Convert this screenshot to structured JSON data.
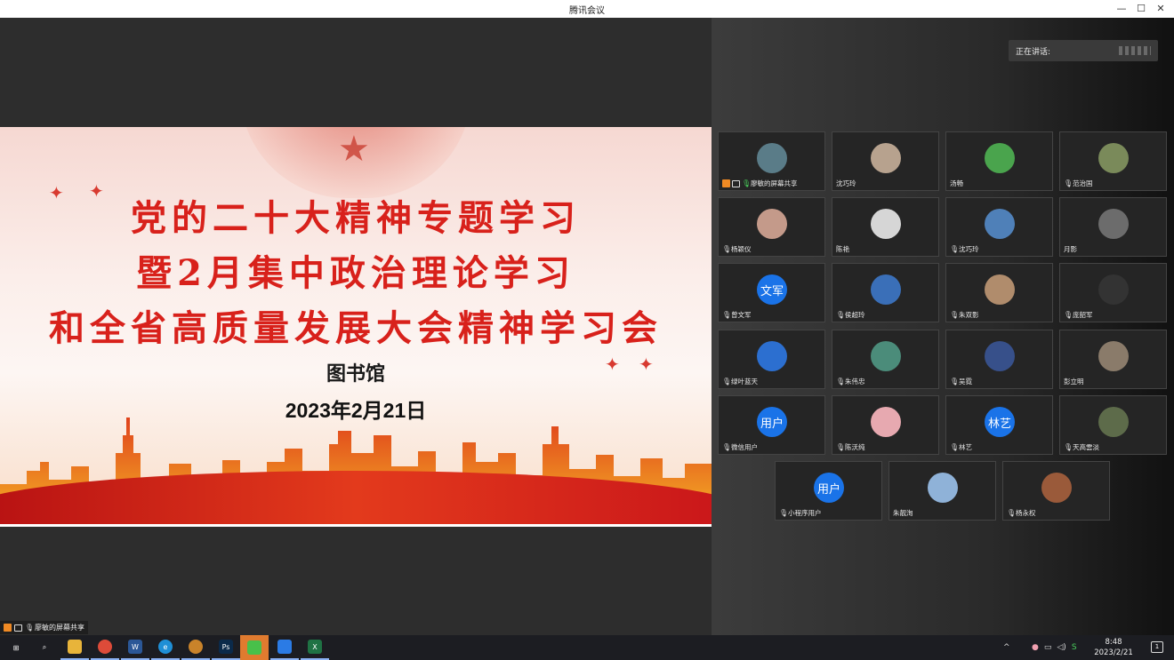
{
  "window": {
    "title": "腾讯会议",
    "minimize": "—",
    "maximize": "☐",
    "close": "✕"
  },
  "slide": {
    "line1": "党的二十大精神专题学习",
    "line2": "暨2月集中政治理论学习",
    "line3": "和全省高质量发展大会精神学习会",
    "org": "图书馆",
    "date": "2023年2月21日"
  },
  "speaking": {
    "label": "正在讲话:"
  },
  "participants": [
    {
      "name": "廖敏的屏幕共享",
      "avatar_color": "#5a7c88",
      "avatar_text": "",
      "mic": "live",
      "sharing": true
    },
    {
      "name": "沈巧玲",
      "avatar_color": "#b7a28e",
      "avatar_text": "",
      "mic": "none",
      "sharing": false
    },
    {
      "name": "汤畅",
      "avatar_color": "#4aa44d",
      "avatar_text": "",
      "mic": "none",
      "sharing": false
    },
    {
      "name": "范治国",
      "avatar_color": "#7a8a5a",
      "avatar_text": "",
      "mic": "muted",
      "sharing": false
    },
    {
      "name": "杨颖仪",
      "avatar_color": "#c49a8a",
      "avatar_text": "",
      "mic": "muted",
      "sharing": false
    },
    {
      "name": "陈艳",
      "avatar_color": "#d6d6d6",
      "avatar_text": "",
      "mic": "none",
      "sharing": false
    },
    {
      "name": "沈巧玲",
      "avatar_color": "#4f80b8",
      "avatar_text": "",
      "mic": "muted",
      "sharing": false
    },
    {
      "name": "月影",
      "avatar_color": "#6c6c6c",
      "avatar_text": "",
      "mic": "none",
      "sharing": false
    },
    {
      "name": "曾文军",
      "avatar_color": "#1a73e8",
      "avatar_text": "文军",
      "mic": "muted",
      "sharing": false
    },
    {
      "name": "侯超玲",
      "avatar_color": "#3a6fb8",
      "avatar_text": "",
      "mic": "muted",
      "sharing": false
    },
    {
      "name": "朱双影",
      "avatar_color": "#b08c6c",
      "avatar_text": "",
      "mic": "muted",
      "sharing": false
    },
    {
      "name": "庞韶军",
      "avatar_color": "#333333",
      "avatar_text": "",
      "mic": "muted",
      "sharing": false
    },
    {
      "name": "绿叶蓝天",
      "avatar_color": "#2c6fd0",
      "avatar_text": "",
      "mic": "muted",
      "sharing": false
    },
    {
      "name": "朱伟忠",
      "avatar_color": "#4b8c7a",
      "avatar_text": "",
      "mic": "muted",
      "sharing": false
    },
    {
      "name": "吴霓",
      "avatar_color": "#37508a",
      "avatar_text": "",
      "mic": "muted",
      "sharing": false
    },
    {
      "name": "彭立明",
      "avatar_color": "#8a7b6a",
      "avatar_text": "",
      "mic": "none",
      "sharing": false
    },
    {
      "name": "微信用户",
      "avatar_color": "#1a73e8",
      "avatar_text": "用户",
      "mic": "muted",
      "sharing": false
    },
    {
      "name": "陈沃纯",
      "avatar_color": "#e7a9b0",
      "avatar_text": "",
      "mic": "muted",
      "sharing": false
    },
    {
      "name": "林艺",
      "avatar_color": "#1a73e8",
      "avatar_text": "林艺",
      "mic": "muted",
      "sharing": false
    },
    {
      "name": "天高雲淡",
      "avatar_color": "#5d6b4a",
      "avatar_text": "",
      "mic": "muted",
      "sharing": false
    },
    {
      "name": "小程序用户",
      "avatar_color": "#1a73e8",
      "avatar_text": "用户",
      "mic": "muted",
      "sharing": false
    },
    {
      "name": "朱靓洵",
      "avatar_color": "#8fb2d8",
      "avatar_text": "",
      "mic": "none",
      "sharing": false
    },
    {
      "name": "杨永权",
      "avatar_color": "#9a5a3a",
      "avatar_text": "",
      "mic": "muted",
      "sharing": false
    }
  ],
  "share_label": "廖敏的屏幕共享",
  "taskbar": {
    "apps": [
      {
        "name": "start-icon",
        "glyph": "⊞",
        "color": "#1c1d22"
      },
      {
        "name": "search-icon",
        "glyph": "⌕",
        "color": "#1c1d22"
      },
      {
        "name": "file-explorer-icon",
        "glyph": "",
        "color": "#e8b43a"
      },
      {
        "name": "chrome-icon",
        "glyph": "",
        "color": "#dd4b39"
      },
      {
        "name": "word-icon",
        "glyph": "W",
        "color": "#2b5797"
      },
      {
        "name": "edge-icon",
        "glyph": "e",
        "color": "#1f8fd6"
      },
      {
        "name": "app-icon",
        "glyph": "",
        "color": "#c9832a"
      },
      {
        "name": "photoshop-icon",
        "glyph": "Ps",
        "color": "#0b2a4a"
      },
      {
        "name": "wechat-icon",
        "glyph": "",
        "color": "#48c04a"
      },
      {
        "name": "tencent-meeting-icon",
        "glyph": "",
        "color": "#2b7be5"
      },
      {
        "name": "excel-icon",
        "glyph": "X",
        "color": "#1f7244"
      }
    ],
    "time": "8:48",
    "date": "2023/2/21",
    "notif_count": "1"
  }
}
